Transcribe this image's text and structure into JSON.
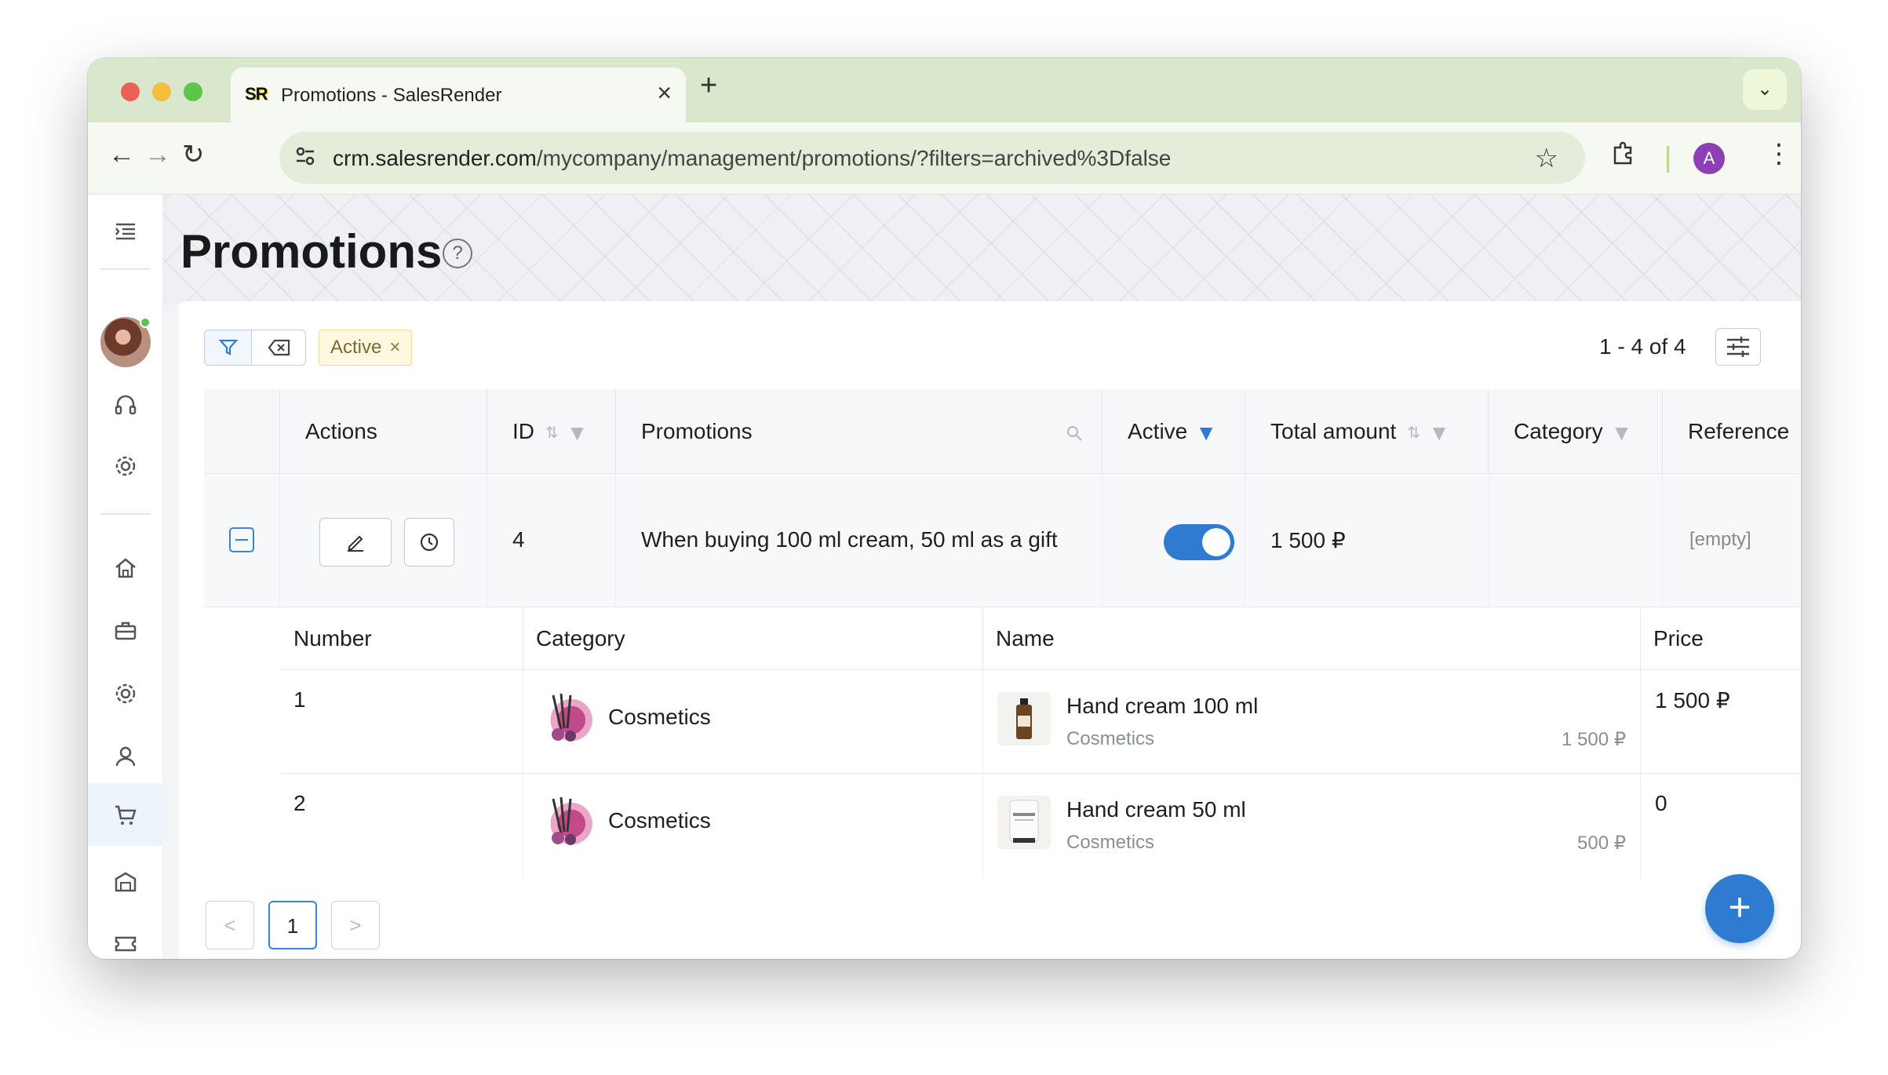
{
  "browser": {
    "tab_title": "Promotions - SalesRender",
    "favicon_text": "SR",
    "url_host": "crm.salesrender.com",
    "url_path": "/mycompany/management/promotions/?filters=archived%3Dfalse",
    "profile_initial": "A"
  },
  "page": {
    "title": "Promotions",
    "help_symbol": "?"
  },
  "filters": {
    "active_chip": "Active",
    "chip_close": "×",
    "counter": "1 - 4 of 4"
  },
  "table": {
    "columns": [
      "Actions",
      "ID",
      "Promotions",
      "Active",
      "Total amount",
      "Category",
      "Reference"
    ],
    "rows": [
      {
        "id": "4",
        "promotion": "When buying 100 ml cream, 50 ml as a gift",
        "active": true,
        "total_amount": "1 500 ₽",
        "category": "",
        "reference": "[empty]"
      }
    ]
  },
  "subtable": {
    "columns": [
      "Number",
      "Category",
      "Name",
      "Price"
    ],
    "rows": [
      {
        "number": "1",
        "category": "Cosmetics",
        "name": "Hand cream 100 ml",
        "name_category": "Cosmetics",
        "name_price": "1 500 ₽",
        "price": "1 500 ₽"
      },
      {
        "number": "2",
        "category": "Cosmetics",
        "name": "Hand cream 50 ml",
        "name_category": "Cosmetics",
        "name_price": "500 ₽",
        "price": "0"
      }
    ]
  },
  "pagination": {
    "prev": "<",
    "current": "1",
    "next": ">"
  },
  "fab_label": "+",
  "colors": {
    "accent": "#2f7bd1",
    "titlebar": "#d9e8cc",
    "chip_bg": "#fff8e1"
  }
}
